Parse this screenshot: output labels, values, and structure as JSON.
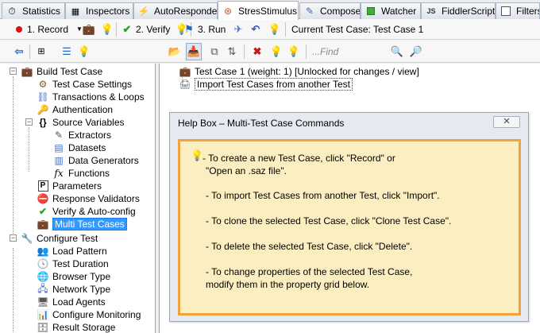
{
  "tabs": [
    {
      "label": "Statistics",
      "icon": "statistics-icon"
    },
    {
      "label": "Inspectors",
      "icon": "inspectors-icon"
    },
    {
      "label": "AutoResponder",
      "icon": "autoresponder-icon"
    },
    {
      "label": "StresStimulus",
      "icon": "stresstimulus-icon"
    },
    {
      "label": "Composer",
      "icon": "composer-icon"
    },
    {
      "label": "Watcher",
      "icon": "watcher-icon"
    },
    {
      "label": "FiddlerScript",
      "icon": "fiddlerscript-icon"
    },
    {
      "label": "Filters",
      "icon": "filters-checkbox"
    }
  ],
  "toolbar1": {
    "record_label": "1. Record",
    "verify_label": "2. Verify",
    "run_label": "3. Run",
    "current_test_case": "Current Test Case: Test Case 1"
  },
  "toolbar2": {
    "find_placeholder": "...Find"
  },
  "tree": {
    "items": [
      {
        "label": "Build Test Case",
        "icon": "briefcase-icon"
      },
      {
        "label": "Test Case Settings",
        "icon": "settings-icon"
      },
      {
        "label": "Transactions & Loops",
        "icon": "transactions-icon"
      },
      {
        "label": "Authentication",
        "icon": "authentication-icon"
      },
      {
        "label": "Source Variables",
        "icon": "braces-icon"
      },
      {
        "label": "Extractors",
        "icon": "extractor-icon"
      },
      {
        "label": "Datasets",
        "icon": "dataset-icon"
      },
      {
        "label": "Data Generators",
        "icon": "data-generator-icon"
      },
      {
        "label": "Functions",
        "icon": "function-icon"
      },
      {
        "label": "Parameters",
        "icon": "parameters-icon"
      },
      {
        "label": "Response Validators",
        "icon": "validator-icon"
      },
      {
        "label": "Verify & Auto-config",
        "icon": "verify-icon"
      },
      {
        "label": "Multi Test Cases",
        "icon": "multi-test-case-icon"
      },
      {
        "label": "Configure Test",
        "icon": "wrench-icon"
      },
      {
        "label": "Load Pattern",
        "icon": "load-pattern-icon"
      },
      {
        "label": "Test Duration",
        "icon": "clock-icon"
      },
      {
        "label": "Browser Type",
        "icon": "browser-icon"
      },
      {
        "label": "Network Type",
        "icon": "network-icon"
      },
      {
        "label": "Load Agents",
        "icon": "load-agents-icon"
      },
      {
        "label": "Configure Monitoring",
        "icon": "monitoring-icon"
      },
      {
        "label": "Result Storage",
        "icon": "storage-icon"
      }
    ]
  },
  "main": {
    "test_case_row": "Test Case 1 (weight: 1) [Unlocked for changes / view]",
    "import_row": "Import Test Cases from another Test"
  },
  "helpbox": {
    "title": "Help Box – Multi-Test Case Commands",
    "lines": [
      "- To create a new Test Case, click \"Record\" or",
      "\"Open an .saz file\".",
      "- To import Test Cases from another Test, click \"Import\".",
      "- To clone the selected Test Case, click \"Clone Test Case\".",
      "- To delete the selected Test Case, click \"Delete\".",
      "- To change properties of the selected Test Case,",
      "modify them in the property grid below."
    ]
  },
  "colors": {
    "selection": "#3399ff",
    "help_border": "#f0a23c",
    "help_background": "#fbefc1"
  }
}
